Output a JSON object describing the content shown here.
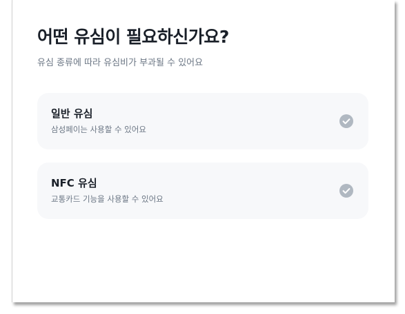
{
  "header": {
    "title": "어떤 유심이 필요하신가요?",
    "subtitle": "유심 종류에 따라 유심비가 부과될 수 있어요"
  },
  "options": [
    {
      "title": "일반 유심",
      "description": "삼성페이는 사용할 수 있어요",
      "icon": "check-circle-icon",
      "checked": false
    },
    {
      "title": "NFC 유심",
      "description": "교통카드 기능을 사용할 수 있어요",
      "icon": "check-circle-icon",
      "checked": false
    }
  ],
  "colors": {
    "title": "#191f28",
    "secondary_text": "#6b7684",
    "card_background": "#f7f8fa",
    "check_inactive": "#b0b8c1"
  }
}
